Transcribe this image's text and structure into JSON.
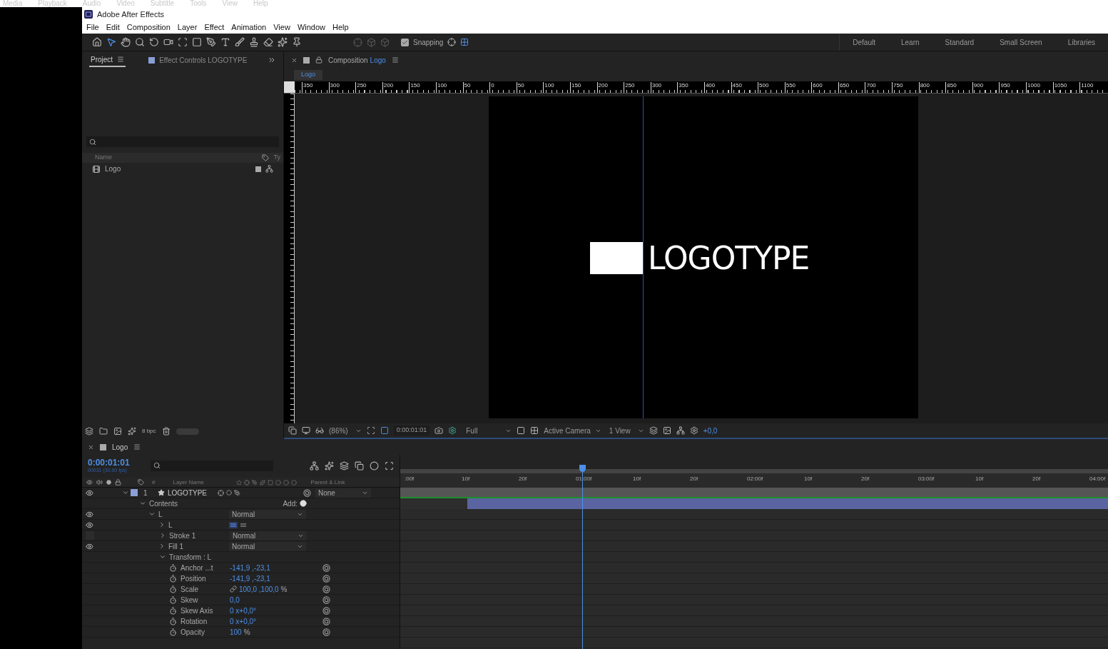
{
  "background_menu": [
    "Media",
    "Playback",
    "Audio",
    "Video",
    "Subtitle",
    "Tools",
    "View",
    "Help"
  ],
  "window": {
    "title": "Adobe After Effects"
  },
  "menu": [
    "File",
    "Edit",
    "Composition",
    "Layer",
    "Effect",
    "Animation",
    "View",
    "Window",
    "Help"
  ],
  "toolbar": {
    "snapping": {
      "label": "Snapping",
      "checked": true
    },
    "workspaces": [
      "Default",
      "Learn",
      "Standard",
      "Small Screen",
      "Libraries"
    ]
  },
  "project": {
    "tabs": [
      {
        "label": "Project",
        "selected": true
      },
      {
        "label": "Effect Controls LOGOTYPE",
        "selected": false
      }
    ],
    "columns": [
      "Name",
      "Ty"
    ],
    "items": [
      {
        "name": "Logo"
      }
    ],
    "bit_depth": "8 bpc"
  },
  "composition": {
    "tab_prefix": "Composition",
    "tab_name": "Logo",
    "subtab": "Logo",
    "ruler": [
      "350",
      "300",
      "250",
      "200",
      "150",
      "100",
      "50",
      "0",
      "50",
      "100",
      "150",
      "200",
      "250",
      "300",
      "350",
      "400",
      "450",
      "500",
      "550",
      "600",
      "650",
      "700",
      "750",
      "800",
      "850",
      "900",
      "950",
      "1000",
      "1050",
      "1100"
    ],
    "canvas_text": "LOGOTYPE",
    "footer": {
      "zoom": "(86%)",
      "time": "0:00:01:01",
      "resolution": "Full",
      "camera": "Active Camera",
      "views": "1 View",
      "exposure": "+0,0"
    }
  },
  "timeline": {
    "tab": "Logo",
    "timecode": "0:00:01:01",
    "frames": "00031 (30.00 fps)",
    "columns": {
      "number": "#",
      "name": "Layer Name",
      "parent": "Parent & Link"
    },
    "ruler": [
      ":00f",
      "10f",
      "20f",
      "01:00f",
      "10f",
      "20f",
      "02:00f",
      "10f",
      "20f",
      "03:00f",
      "10f",
      "20f",
      "04:00f"
    ],
    "layers": [
      {
        "number": "1",
        "name": "LOGOTYPE",
        "color": "#8a9fd6",
        "visible": true,
        "expanded": true,
        "parent": "None",
        "children": [
          {
            "kind": "group",
            "name": "Contents",
            "expanded": true,
            "add": "Add:",
            "children": [
              {
                "kind": "group",
                "name": "L",
                "visible": true,
                "expanded": true,
                "mode": "Normal",
                "children": [
                  {
                    "kind": "path",
                    "name": "L",
                    "visible": true,
                    "expanded": false
                  },
                  {
                    "kind": "group",
                    "name": "Stroke 1",
                    "visible": false,
                    "expanded": false,
                    "mode": "Normal"
                  },
                  {
                    "kind": "group",
                    "name": "Fill 1",
                    "visible": true,
                    "expanded": false,
                    "mode": "Normal"
                  },
                  {
                    "kind": "group",
                    "name": "Transform : L",
                    "expanded": true,
                    "children": [
                      {
                        "kind": "property",
                        "name": "Anchor ...t",
                        "value": "-141,9 ,-23,1"
                      },
                      {
                        "kind": "property",
                        "name": "Position",
                        "value": "-141,9 ,-23,1"
                      },
                      {
                        "kind": "property",
                        "name": "Scale",
                        "value": "100,0 ,100,0",
                        "unit": "%",
                        "linked": true
                      },
                      {
                        "kind": "property",
                        "name": "Skew",
                        "value": "0,0"
                      },
                      {
                        "kind": "property",
                        "name": "Skew Axis",
                        "value": "0 x+0,0°"
                      },
                      {
                        "kind": "property",
                        "name": "Rotation",
                        "value": "0 x+0,0°"
                      },
                      {
                        "kind": "property",
                        "name": "Opacity",
                        "value": "100",
                        "unit": "%"
                      }
                    ]
                  }
                ]
              }
            ]
          }
        ]
      }
    ]
  }
}
